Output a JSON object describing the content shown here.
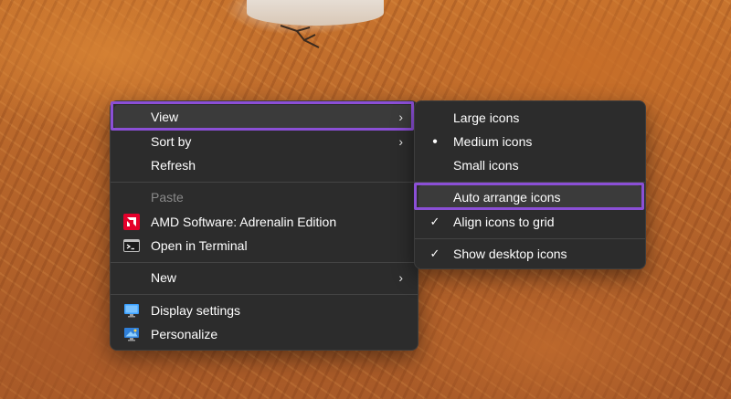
{
  "main_menu": {
    "items": [
      {
        "label": "View",
        "submenu": true
      },
      {
        "label": "Sort by",
        "submenu": true
      },
      {
        "label": "Refresh"
      },
      {
        "label": "Paste",
        "disabled": true
      },
      {
        "label": "AMD Software: Adrenalin Edition",
        "icon": "amd-icon"
      },
      {
        "label": "Open in Terminal",
        "icon": "terminal-icon"
      },
      {
        "label": "New",
        "submenu": true
      },
      {
        "label": "Display settings",
        "icon": "display-icon"
      },
      {
        "label": "Personalize",
        "icon": "personalize-icon"
      }
    ],
    "arrow_glyph": "›"
  },
  "view_submenu": {
    "items": [
      {
        "label": "Large icons"
      },
      {
        "label": "Medium icons",
        "marker": "●"
      },
      {
        "label": "Small icons"
      },
      {
        "label": "Auto arrange icons"
      },
      {
        "label": "Align icons to grid",
        "marker": "✓"
      },
      {
        "label": "Show desktop icons",
        "marker": "✓"
      }
    ]
  },
  "colors": {
    "highlight_outline": "#8b4fd6",
    "menu_background": "#2c2c2c",
    "amd_red": "#e4002b"
  }
}
